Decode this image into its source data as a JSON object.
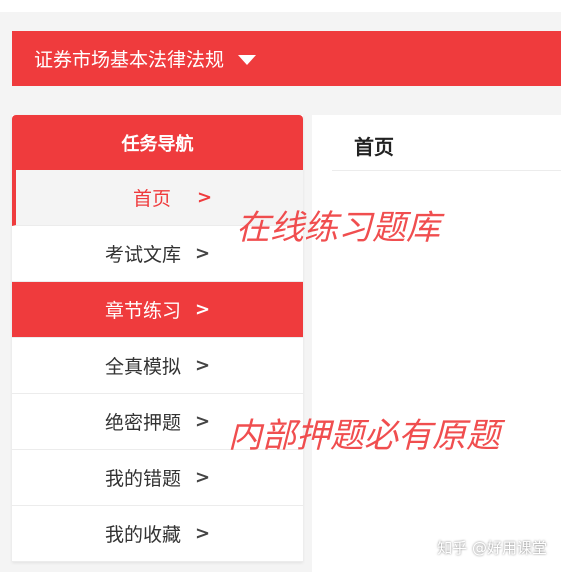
{
  "subject_selector": {
    "label": "证券市场基本法律法规"
  },
  "sidebar": {
    "header": "任务导航",
    "items": [
      {
        "label": "首页",
        "arrow": ">"
      },
      {
        "label": "考试文库",
        "arrow": ">"
      },
      {
        "label": "章节练习",
        "arrow": ">"
      },
      {
        "label": "全真模拟",
        "arrow": ">"
      },
      {
        "label": "绝密押题",
        "arrow": ">"
      },
      {
        "label": "我的错题",
        "arrow": ">"
      },
      {
        "label": "我的收藏",
        "arrow": ">"
      }
    ]
  },
  "main": {
    "title": "首页"
  },
  "overlays": {
    "text1": "在线练习题库",
    "text2": "内部押题必有原题"
  },
  "watermark": "知乎 @好用课堂",
  "colors": {
    "accent": "#ef3b3d",
    "background": "#f4f4f4"
  }
}
